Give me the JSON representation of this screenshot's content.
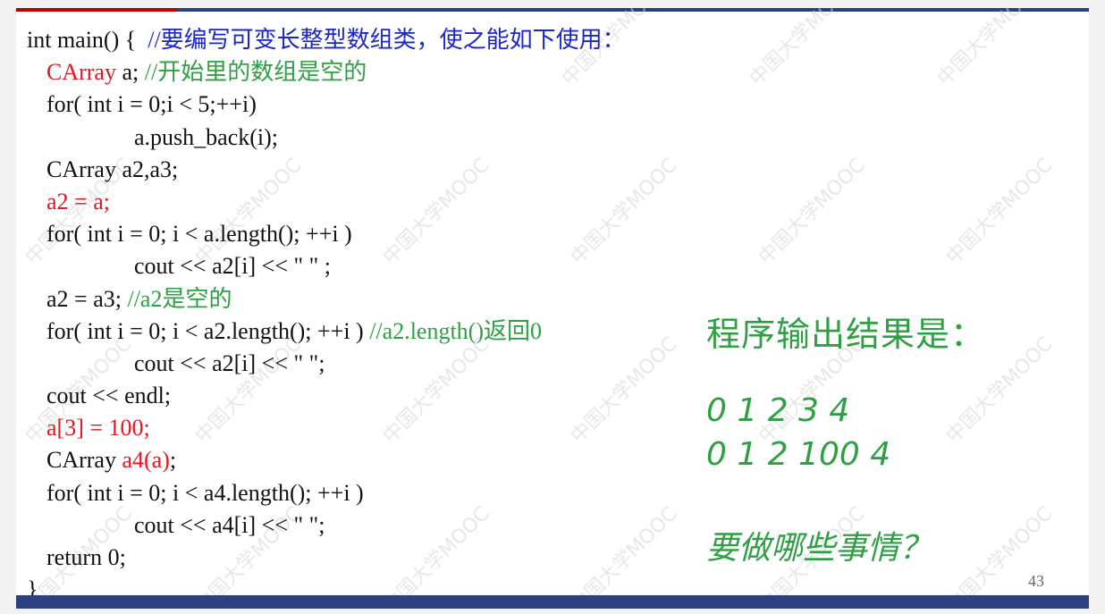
{
  "watermark": "中国大学MOOC",
  "code": {
    "l1_a": "int main() {  ",
    "l1_b": "//要编写可变长整型数组类，使之能如下使用：",
    "l2_a": "CArray",
    "l2_b": " a; ",
    "l2_c": "//开始里的数组是空的",
    "l3": "for( int i = 0;i < 5;++i)",
    "l4": "a.push_back(i);",
    "l5": "CArray a2,a3;",
    "l6": "a2 = a;",
    "l7": "for( int i = 0; i < a.length(); ++i )",
    "l8": "cout << a2[i] << \" \" ;",
    "l9_a": "a2 = a3; ",
    "l9_b": "//a2是空的",
    "l10_a": "for( int i = 0; i < a2.length(); ++i ) ",
    "l10_b": "//a2.length()返回0",
    "l11": "cout << a2[i] << \" \";",
    "l12": "cout << endl;",
    "l13": "a[3] = 100;",
    "l14_a": "CArray ",
    "l14_b": "a4(a)",
    "l14_c": ";",
    "l15": "for( int i = 0; i < a4.length(); ++i )",
    "l16": "cout << a4[i] << \" \";",
    "l17": "return 0;",
    "l18": "}"
  },
  "output": {
    "title": "程序输出结果是：",
    "line1": "0 1 2 3 4",
    "line2": "0 1 2 100 4",
    "question": "要做哪些事情？"
  },
  "page_number": "43"
}
